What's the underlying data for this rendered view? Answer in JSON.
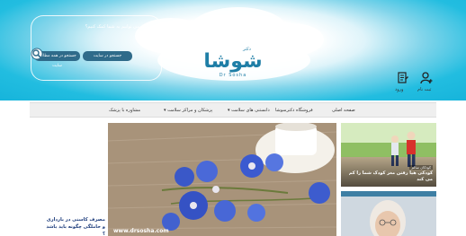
{
  "search": {
    "question": "چگونه می توانیم به شما کمک کنیم؟",
    "site_label": "جستجو در سایت",
    "all_label": "جستجو در همه مطالب سایت",
    "icon": "search-icon"
  },
  "brand": {
    "logo_text": "شوشا",
    "logo_small": "دکتر",
    "logo_sub": "Dr Sosha"
  },
  "user": {
    "login_label": "ورود",
    "register_label": "ثبت نام"
  },
  "nav": {
    "items": [
      {
        "label": "صفحه اصلی"
      },
      {
        "label": "فروشگاه دکترسوشا"
      },
      {
        "label": "دانستنی های سلامت ▾"
      },
      {
        "label": "پزشکان و مراکز سلامت ▾"
      },
      {
        "label": "مشاوره با پزشک"
      }
    ]
  },
  "articles": {
    "sidebar_title": "مصرف کاسنی در بارداری و حاملگی چگونه باید باشد ؟",
    "hero_watermark": "www.drsosha.com",
    "card_1_badge": "کودکان سالم",
    "card_1_title": "کودکی هیا رفتن مغز کودک شما را کم می کند"
  },
  "colors": {
    "accent": "#16b4db",
    "nav_bg": "#efefef",
    "button": "#2f6b8a",
    "logo": "#1f7ea6"
  }
}
